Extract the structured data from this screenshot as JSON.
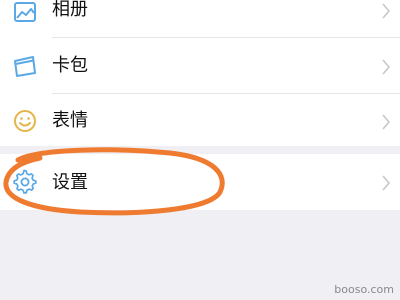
{
  "menu": {
    "items": [
      {
        "label": "相册",
        "icon": "album-icon"
      },
      {
        "label": "卡包",
        "icon": "card-wallet-icon"
      },
      {
        "label": "表情",
        "icon": "emoji-icon"
      }
    ],
    "settings": {
      "label": "设置",
      "icon": "gear-icon"
    }
  },
  "watermark": "booso.com",
  "colors": {
    "icon_blue": "#5aa9e6",
    "icon_yellow": "#e6b54a",
    "annotation_orange": "#ef7b30",
    "chevron": "#c7c7cc"
  }
}
